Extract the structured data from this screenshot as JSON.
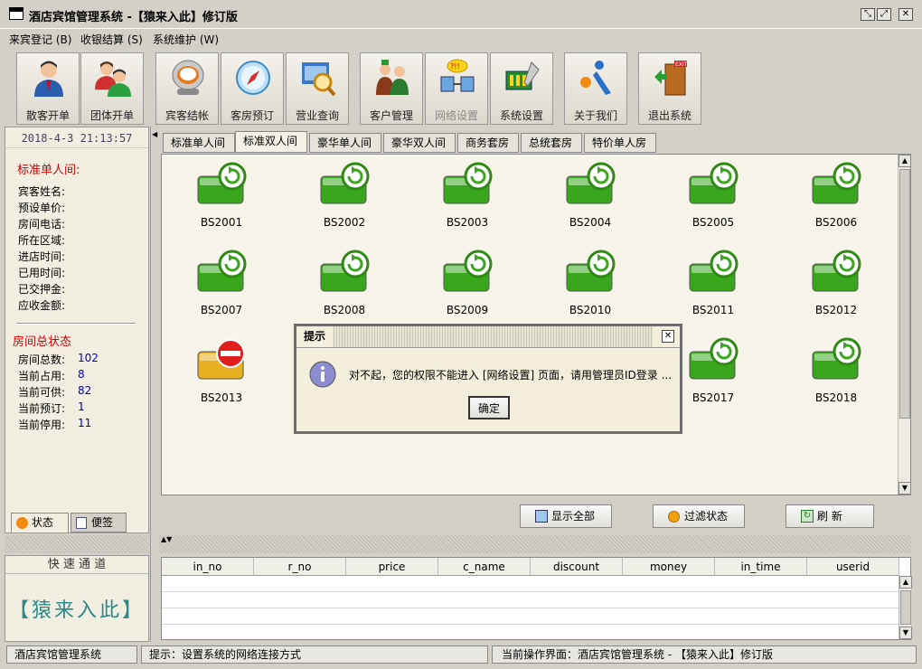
{
  "window": {
    "title": "酒店宾馆管理系统 -【猿来入此】修订版"
  },
  "menu": [
    {
      "label": "来宾登记 (B)"
    },
    {
      "label": "收银结算 (S)"
    },
    {
      "label": "系统维护 (W)"
    }
  ],
  "toolbar": [
    {
      "label": "散客开单",
      "icon": "guest-icon"
    },
    {
      "label": "团体开单",
      "icon": "group-icon"
    },
    {
      "label": "宾客结帐",
      "icon": "checkout-icon"
    },
    {
      "label": "客房预订",
      "icon": "compass-icon"
    },
    {
      "label": "营业查询",
      "icon": "search-icon"
    },
    {
      "label": "客户管理",
      "icon": "customer-icon"
    },
    {
      "label": "网络设置",
      "icon": "network-icon"
    },
    {
      "label": "系统设置",
      "icon": "settings-icon"
    },
    {
      "label": "关于我们",
      "icon": "about-icon"
    },
    {
      "label": "退出系统",
      "icon": "exit-icon"
    }
  ],
  "left": {
    "datetime": "2018-4-3 21:13:57",
    "room_type_title": "标准单人间:",
    "fields": [
      "宾客姓名:",
      "预设单价:",
      "房间电话:",
      "所在区域:",
      "进店时间:",
      "已用时间:",
      "已交押金:",
      "应收金额:"
    ],
    "status_title": "房间总状态",
    "stats": [
      {
        "label": "房间总数:",
        "value": "102"
      },
      {
        "label": "当前占用:",
        "value": "8"
      },
      {
        "label": "当前可供:",
        "value": "82"
      },
      {
        "label": "当前预订:",
        "value": "1"
      },
      {
        "label": "当前停用:",
        "value": "11"
      }
    ],
    "tabs": [
      {
        "label": "状态"
      },
      {
        "label": "便签"
      }
    ],
    "quick_title": "快 速 通 道",
    "quick_brand": "【猿来入此】"
  },
  "room_tabs": [
    {
      "label": "标准单人间"
    },
    {
      "label": "标准双人间",
      "active": true
    },
    {
      "label": "豪华单人间"
    },
    {
      "label": "豪华双人间"
    },
    {
      "label": "商务套房"
    },
    {
      "label": "总统套房"
    },
    {
      "label": "特价单人房"
    }
  ],
  "rooms": [
    {
      "id": "BS2001",
      "status": "available"
    },
    {
      "id": "BS2002",
      "status": "available"
    },
    {
      "id": "BS2003",
      "status": "available"
    },
    {
      "id": "BS2004",
      "status": "available"
    },
    {
      "id": "BS2005",
      "status": "available"
    },
    {
      "id": "BS2006",
      "status": "available"
    },
    {
      "id": "BS2007",
      "status": "available"
    },
    {
      "id": "BS2008",
      "status": "available"
    },
    {
      "id": "BS2009",
      "status": "available"
    },
    {
      "id": "BS2010",
      "status": "available"
    },
    {
      "id": "BS2011",
      "status": "available"
    },
    {
      "id": "BS2012",
      "status": "available"
    },
    {
      "id": "BS2013",
      "status": "disabled"
    },
    {
      "id": "BS2017",
      "status": "available"
    },
    {
      "id": "BS2018",
      "status": "available"
    }
  ],
  "actions": {
    "show_all": "显示全部",
    "filter": "过滤状态",
    "refresh": "刷 新"
  },
  "grid": {
    "columns": [
      "in_no",
      "r_no",
      "price",
      "c_name",
      "discount",
      "money",
      "in_time",
      "userid"
    ]
  },
  "dialog": {
    "title": "提示",
    "message": "对不起，您的权限不能进入 [网络设置] 页面，请用管理员ID登录 ...",
    "ok": "确定"
  },
  "status": {
    "app": "酒店宾馆管理系统",
    "hint": "提示：设置系统的网络连接方式",
    "current": "当前操作界面：酒店宾馆管理系统 - 【猿来入此】修订版"
  },
  "colors": {
    "room_available": "#3aa61e",
    "room_disabled": "#e8b020",
    "status_red": "#d40000",
    "value_blue": "#0000cc"
  }
}
